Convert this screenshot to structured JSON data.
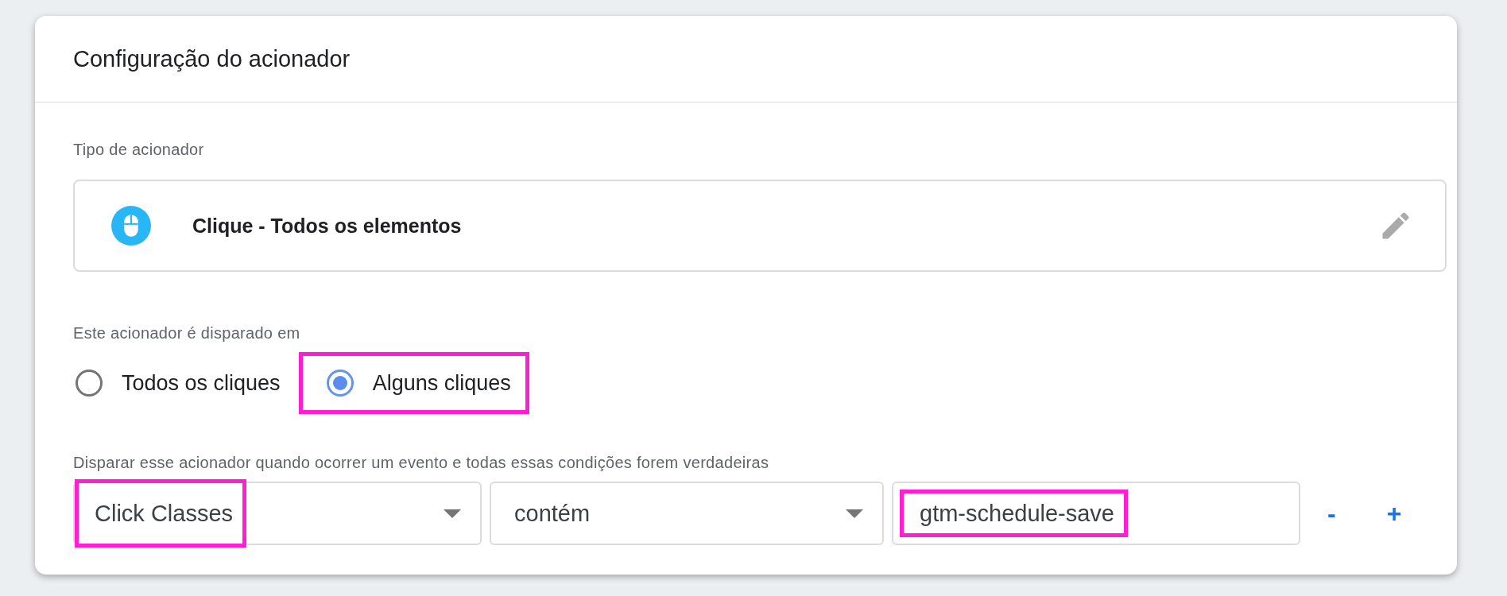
{
  "card": {
    "title": "Configuração do acionador"
  },
  "trigger_type": {
    "label": "Tipo de acionador",
    "name": "Clique - Todos os elementos"
  },
  "fires_on": {
    "label": "Este acionador é disparado em",
    "options": [
      {
        "label": "Todos os cliques",
        "selected": false,
        "highlighted": false
      },
      {
        "label": "Alguns cliques",
        "selected": true,
        "highlighted": true
      }
    ]
  },
  "conditions": {
    "label": "Disparar esse acionador quando ocorrer um evento e todas essas condições forem verdadeiras",
    "row": {
      "variable": {
        "value": "Click Classes",
        "highlighted": true
      },
      "operator": {
        "value": "contém",
        "highlighted": false
      },
      "match": {
        "value": "gtm-schedule-save",
        "highlighted": true
      },
      "remove": "-",
      "add": "+"
    }
  }
}
